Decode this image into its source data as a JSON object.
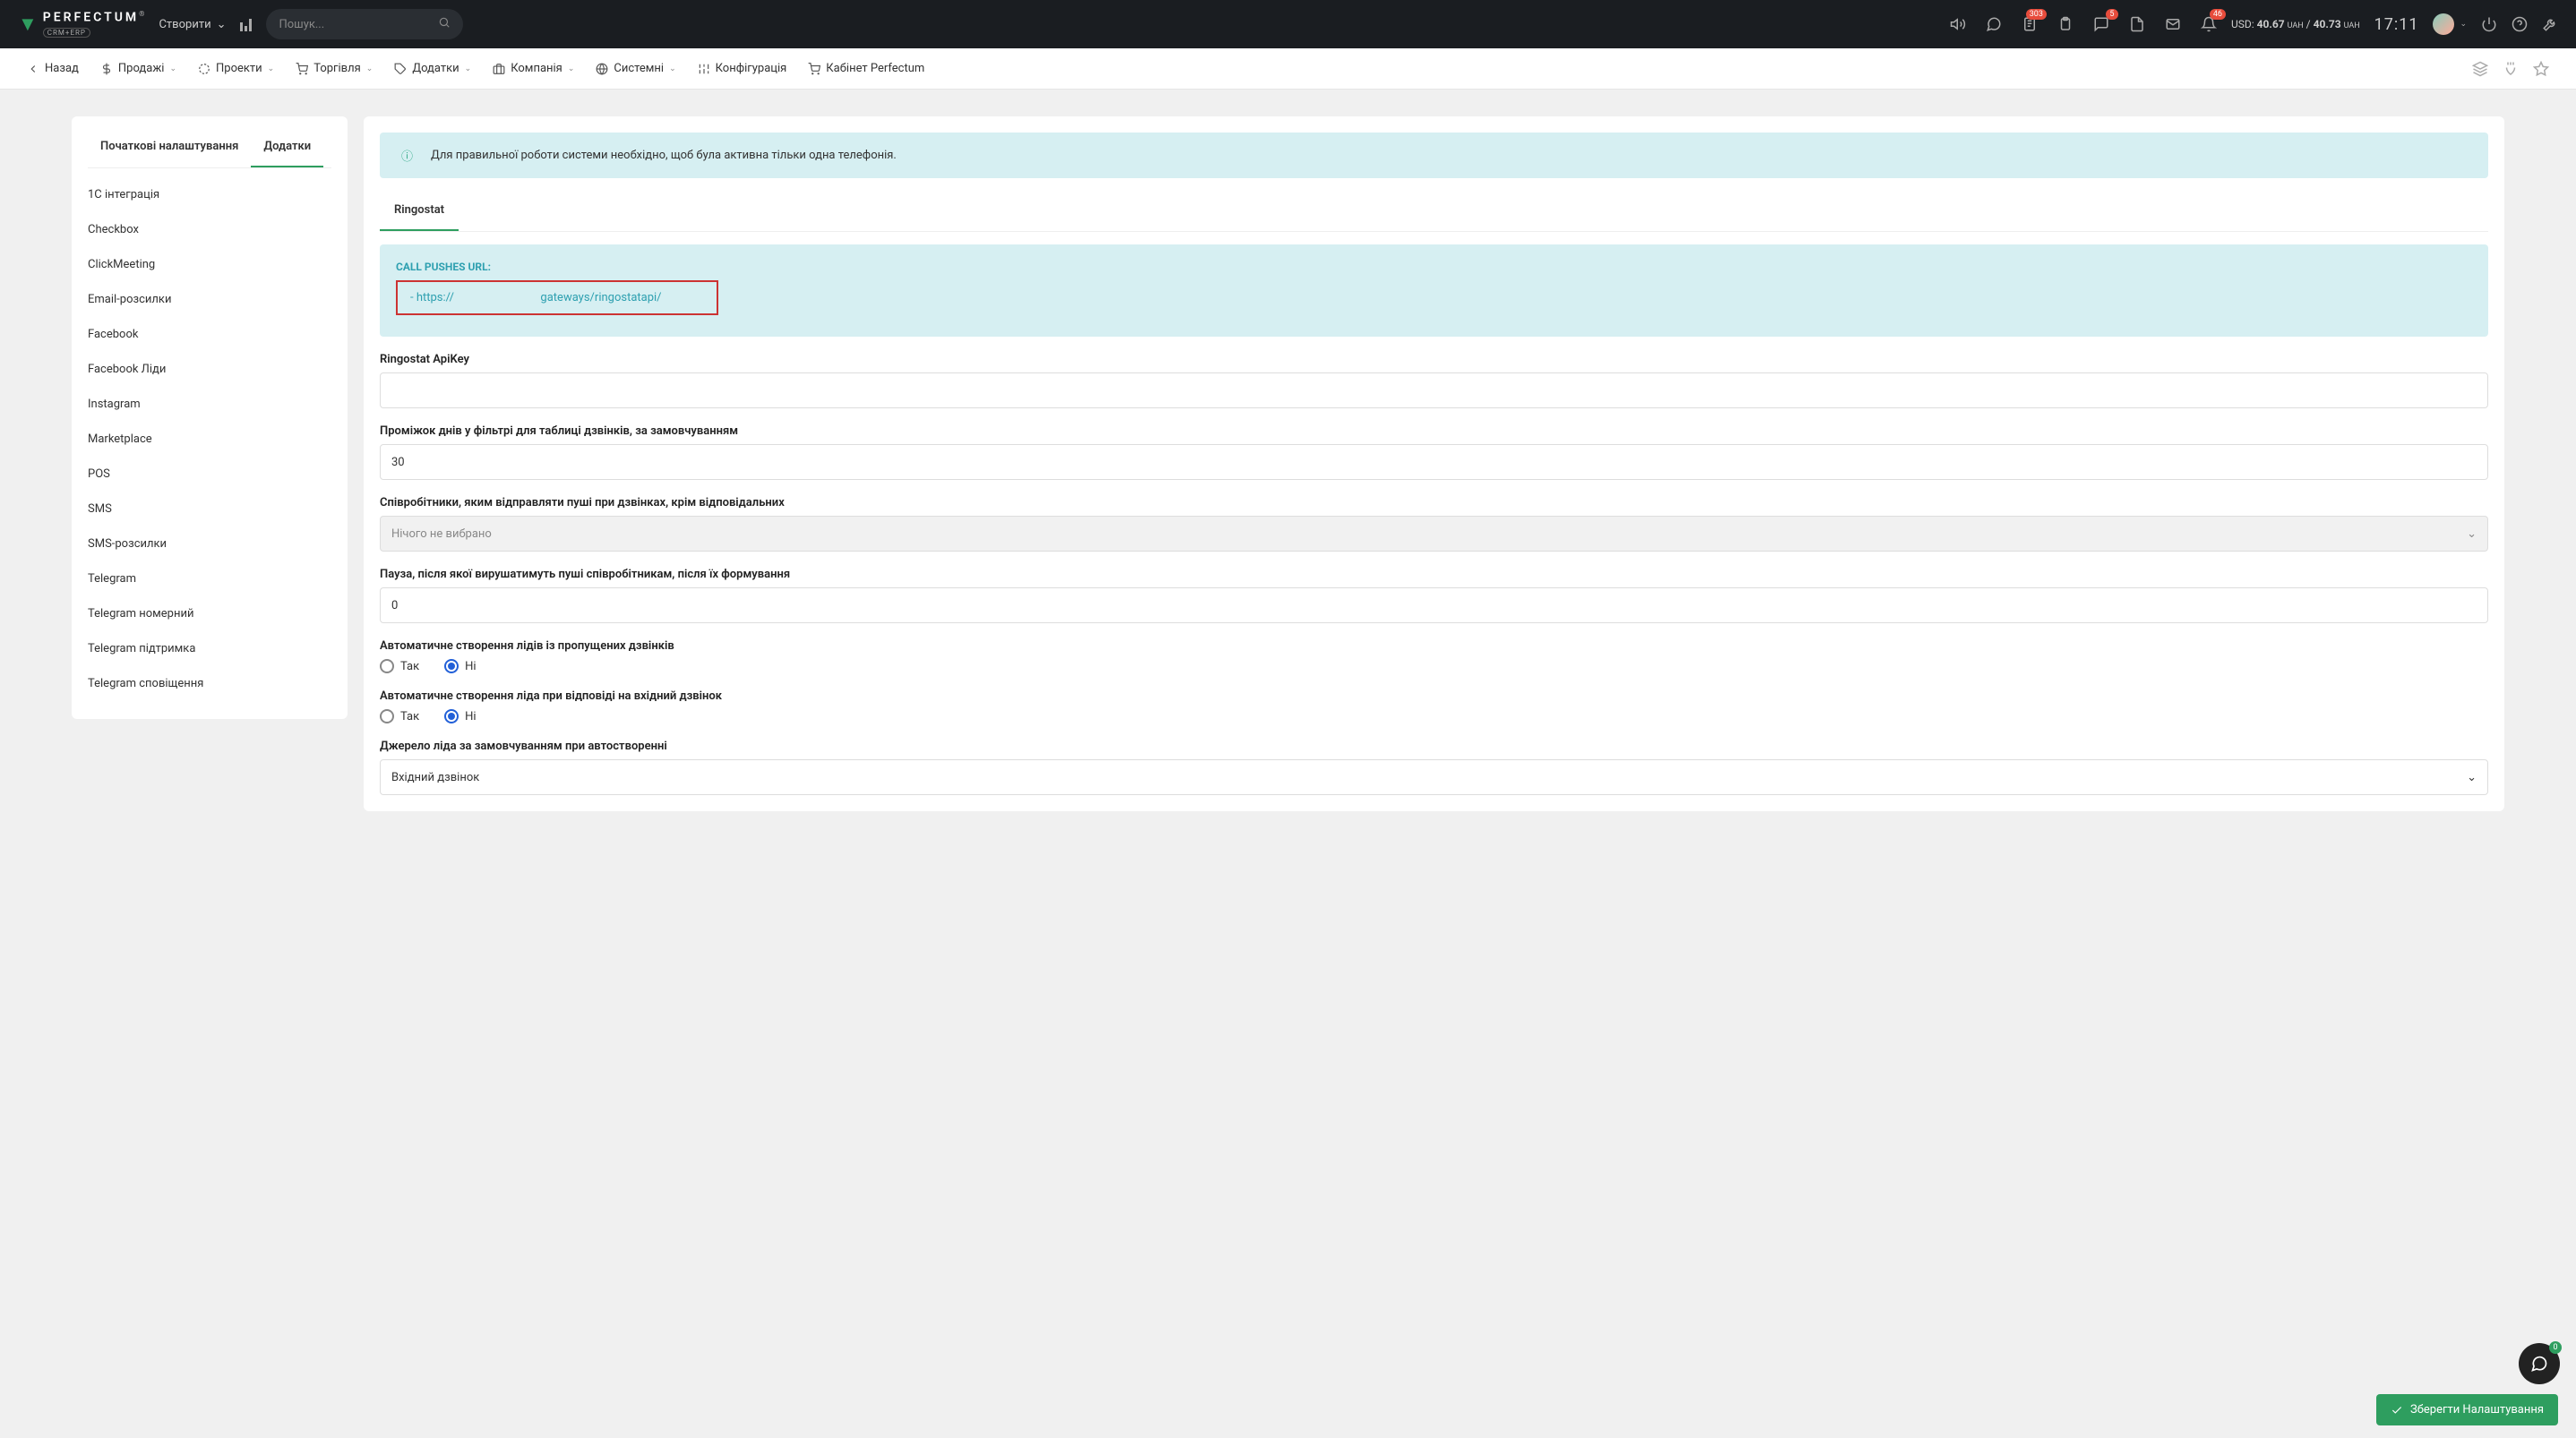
{
  "header": {
    "create_label": "Створити",
    "search_placeholder": "Пошук...",
    "badges": {
      "tasks": "303",
      "chat": "5",
      "bell": "46"
    },
    "currency": {
      "prefix": "USD:",
      "buy": "40.67",
      "uah1": "UAH",
      "sep": "/",
      "sell": "40.73",
      "uah2": "UAH"
    },
    "time": "17:11"
  },
  "nav": {
    "back": "Назад",
    "sales": "Продажі",
    "projects": "Проекти",
    "trade": "Торгівля",
    "addons": "Додатки",
    "company": "Компанія",
    "system": "Системні",
    "config": "Конфігурація",
    "cabinet": "Кабінет Perfectum"
  },
  "sidebar": {
    "tabs": {
      "initial": "Початкові налаштування",
      "addons": "Додатки"
    },
    "items": [
      "1С інтеграція",
      "Checkbox",
      "ClickMeeting",
      "Email-розсилки",
      "Facebook",
      "Facebook Ліди",
      "Instagram",
      "Marketplace",
      "POS",
      "SMS",
      "SMS-розсилки",
      "Telegram",
      "Telegram номерний",
      "Telegram підтримка",
      "Telegram сповіщення"
    ]
  },
  "content": {
    "banner": "Для правильної роботи системи необхідно, щоб була активна тільки одна телефонія.",
    "tab": "Ringostat",
    "url_title": "CALL PUSHES URL:",
    "url_prefix": "- https://",
    "url_suffix": "gateways/ringostatapi/",
    "apikey_label": "Ringostat ApiKey",
    "apikey_value": "",
    "days_label": "Проміжок днів у фільтрі для таблиці дзвінків, за замовчуванням",
    "days_value": "30",
    "staff_label": "Співробітники, яким відправляти пуші при дзвінках, крім відповідальних",
    "staff_placeholder": "Нічого не вибрано",
    "pause_label": "Пауза, після якої вирушатимуть пуші співробітникам, після їх формування",
    "pause_value": "0",
    "autolead_missed_label": "Автоматичне створення лідів із пропущених дзвінків",
    "autolead_answered_label": "Автоматичне створення ліда при відповіді на вхідний дзвінок",
    "yes": "Так",
    "no": "Ні",
    "leadsource_label": "Джерело ліда за замовчуванням при автостворенні",
    "leadsource_value": "Вхідний дзвінок",
    "save": "Зберегти Налаштування",
    "fab_badge": "0"
  }
}
